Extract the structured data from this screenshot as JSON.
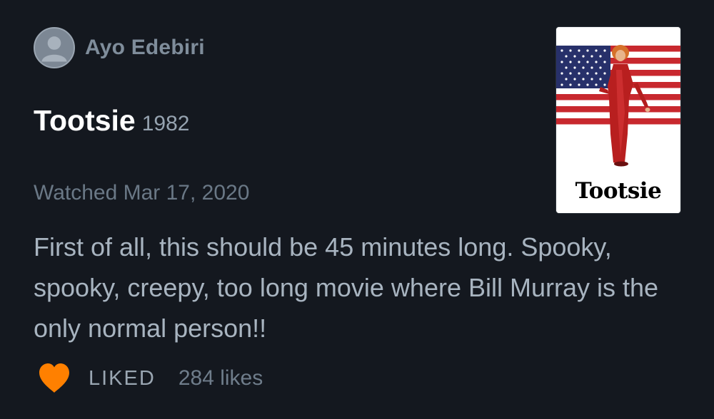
{
  "author": {
    "name": "Ayo Edebiri"
  },
  "film": {
    "title": "Tootsie",
    "year": "1982"
  },
  "watched": "Watched Mar 17, 2020",
  "review": "First of all, this should be 45 minutes long. Spooky, spooky, creepy, too long movie where Bill Murray is the only normal person!!",
  "footer": {
    "liked_label": "LIKED",
    "likes": "284 likes"
  },
  "poster": {
    "title": "Tootsie"
  },
  "colors": {
    "background": "#14181f",
    "heart": "#ff8000",
    "poster_red": "#c8282e",
    "poster_blue": "#27306a"
  },
  "icons": {
    "avatar": "default-user-icon",
    "like": "heart-icon"
  }
}
